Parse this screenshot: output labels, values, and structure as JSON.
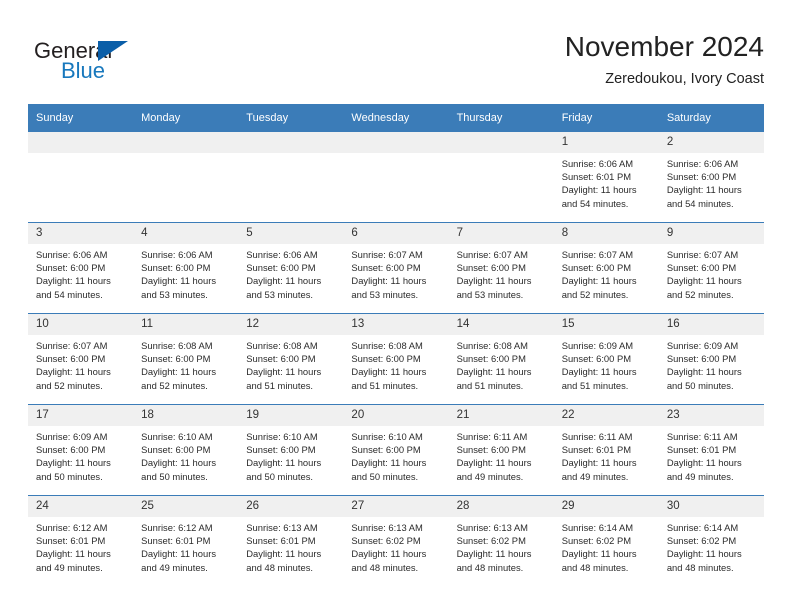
{
  "brand": {
    "name_part1": "General",
    "name_part2": "Blue",
    "accent_color": "#0a5ea8",
    "blue_text_color": "#1878bd"
  },
  "header": {
    "title": "November 2024",
    "subtitle": "Zeredoukou, Ivory Coast"
  },
  "theme": {
    "header_row_bg": "#3b7cb8",
    "daynum_bg": "#f0f0f0",
    "text_color": "#222222"
  },
  "columns": [
    {
      "label": "Sunday"
    },
    {
      "label": "Monday"
    },
    {
      "label": "Tuesday"
    },
    {
      "label": "Wednesday"
    },
    {
      "label": "Thursday"
    },
    {
      "label": "Friday"
    },
    {
      "label": "Saturday"
    }
  ],
  "weeks": [
    {
      "days": [
        {
          "daynum": "",
          "empty": true,
          "sunrise": "",
          "sunset": "",
          "daylight_line1": "",
          "daylight_line2": ""
        },
        {
          "daynum": "",
          "empty": true,
          "sunrise": "",
          "sunset": "",
          "daylight_line1": "",
          "daylight_line2": ""
        },
        {
          "daynum": "",
          "empty": true,
          "sunrise": "",
          "sunset": "",
          "daylight_line1": "",
          "daylight_line2": ""
        },
        {
          "daynum": "",
          "empty": true,
          "sunrise": "",
          "sunset": "",
          "daylight_line1": "",
          "daylight_line2": ""
        },
        {
          "daynum": "",
          "empty": true,
          "sunrise": "",
          "sunset": "",
          "daylight_line1": "",
          "daylight_line2": ""
        },
        {
          "daynum": "1",
          "empty": false,
          "sunrise": "Sunrise: 6:06 AM",
          "sunset": "Sunset: 6:01 PM",
          "daylight_line1": "Daylight: 11 hours",
          "daylight_line2": "and 54 minutes."
        },
        {
          "daynum": "2",
          "empty": false,
          "sunrise": "Sunrise: 6:06 AM",
          "sunset": "Sunset: 6:00 PM",
          "daylight_line1": "Daylight: 11 hours",
          "daylight_line2": "and 54 minutes."
        }
      ]
    },
    {
      "days": [
        {
          "daynum": "3",
          "empty": false,
          "sunrise": "Sunrise: 6:06 AM",
          "sunset": "Sunset: 6:00 PM",
          "daylight_line1": "Daylight: 11 hours",
          "daylight_line2": "and 54 minutes."
        },
        {
          "daynum": "4",
          "empty": false,
          "sunrise": "Sunrise: 6:06 AM",
          "sunset": "Sunset: 6:00 PM",
          "daylight_line1": "Daylight: 11 hours",
          "daylight_line2": "and 53 minutes."
        },
        {
          "daynum": "5",
          "empty": false,
          "sunrise": "Sunrise: 6:06 AM",
          "sunset": "Sunset: 6:00 PM",
          "daylight_line1": "Daylight: 11 hours",
          "daylight_line2": "and 53 minutes."
        },
        {
          "daynum": "6",
          "empty": false,
          "sunrise": "Sunrise: 6:07 AM",
          "sunset": "Sunset: 6:00 PM",
          "daylight_line1": "Daylight: 11 hours",
          "daylight_line2": "and 53 minutes."
        },
        {
          "daynum": "7",
          "empty": false,
          "sunrise": "Sunrise: 6:07 AM",
          "sunset": "Sunset: 6:00 PM",
          "daylight_line1": "Daylight: 11 hours",
          "daylight_line2": "and 53 minutes."
        },
        {
          "daynum": "8",
          "empty": false,
          "sunrise": "Sunrise: 6:07 AM",
          "sunset": "Sunset: 6:00 PM",
          "daylight_line1": "Daylight: 11 hours",
          "daylight_line2": "and 52 minutes."
        },
        {
          "daynum": "9",
          "empty": false,
          "sunrise": "Sunrise: 6:07 AM",
          "sunset": "Sunset: 6:00 PM",
          "daylight_line1": "Daylight: 11 hours",
          "daylight_line2": "and 52 minutes."
        }
      ]
    },
    {
      "days": [
        {
          "daynum": "10",
          "empty": false,
          "sunrise": "Sunrise: 6:07 AM",
          "sunset": "Sunset: 6:00 PM",
          "daylight_line1": "Daylight: 11 hours",
          "daylight_line2": "and 52 minutes."
        },
        {
          "daynum": "11",
          "empty": false,
          "sunrise": "Sunrise: 6:08 AM",
          "sunset": "Sunset: 6:00 PM",
          "daylight_line1": "Daylight: 11 hours",
          "daylight_line2": "and 52 minutes."
        },
        {
          "daynum": "12",
          "empty": false,
          "sunrise": "Sunrise: 6:08 AM",
          "sunset": "Sunset: 6:00 PM",
          "daylight_line1": "Daylight: 11 hours",
          "daylight_line2": "and 51 minutes."
        },
        {
          "daynum": "13",
          "empty": false,
          "sunrise": "Sunrise: 6:08 AM",
          "sunset": "Sunset: 6:00 PM",
          "daylight_line1": "Daylight: 11 hours",
          "daylight_line2": "and 51 minutes."
        },
        {
          "daynum": "14",
          "empty": false,
          "sunrise": "Sunrise: 6:08 AM",
          "sunset": "Sunset: 6:00 PM",
          "daylight_line1": "Daylight: 11 hours",
          "daylight_line2": "and 51 minutes."
        },
        {
          "daynum": "15",
          "empty": false,
          "sunrise": "Sunrise: 6:09 AM",
          "sunset": "Sunset: 6:00 PM",
          "daylight_line1": "Daylight: 11 hours",
          "daylight_line2": "and 51 minutes."
        },
        {
          "daynum": "16",
          "empty": false,
          "sunrise": "Sunrise: 6:09 AM",
          "sunset": "Sunset: 6:00 PM",
          "daylight_line1": "Daylight: 11 hours",
          "daylight_line2": "and 50 minutes."
        }
      ]
    },
    {
      "days": [
        {
          "daynum": "17",
          "empty": false,
          "sunrise": "Sunrise: 6:09 AM",
          "sunset": "Sunset: 6:00 PM",
          "daylight_line1": "Daylight: 11 hours",
          "daylight_line2": "and 50 minutes."
        },
        {
          "daynum": "18",
          "empty": false,
          "sunrise": "Sunrise: 6:10 AM",
          "sunset": "Sunset: 6:00 PM",
          "daylight_line1": "Daylight: 11 hours",
          "daylight_line2": "and 50 minutes."
        },
        {
          "daynum": "19",
          "empty": false,
          "sunrise": "Sunrise: 6:10 AM",
          "sunset": "Sunset: 6:00 PM",
          "daylight_line1": "Daylight: 11 hours",
          "daylight_line2": "and 50 minutes."
        },
        {
          "daynum": "20",
          "empty": false,
          "sunrise": "Sunrise: 6:10 AM",
          "sunset": "Sunset: 6:00 PM",
          "daylight_line1": "Daylight: 11 hours",
          "daylight_line2": "and 50 minutes."
        },
        {
          "daynum": "21",
          "empty": false,
          "sunrise": "Sunrise: 6:11 AM",
          "sunset": "Sunset: 6:00 PM",
          "daylight_line1": "Daylight: 11 hours",
          "daylight_line2": "and 49 minutes."
        },
        {
          "daynum": "22",
          "empty": false,
          "sunrise": "Sunrise: 6:11 AM",
          "sunset": "Sunset: 6:01 PM",
          "daylight_line1": "Daylight: 11 hours",
          "daylight_line2": "and 49 minutes."
        },
        {
          "daynum": "23",
          "empty": false,
          "sunrise": "Sunrise: 6:11 AM",
          "sunset": "Sunset: 6:01 PM",
          "daylight_line1": "Daylight: 11 hours",
          "daylight_line2": "and 49 minutes."
        }
      ]
    },
    {
      "days": [
        {
          "daynum": "24",
          "empty": false,
          "sunrise": "Sunrise: 6:12 AM",
          "sunset": "Sunset: 6:01 PM",
          "daylight_line1": "Daylight: 11 hours",
          "daylight_line2": "and 49 minutes."
        },
        {
          "daynum": "25",
          "empty": false,
          "sunrise": "Sunrise: 6:12 AM",
          "sunset": "Sunset: 6:01 PM",
          "daylight_line1": "Daylight: 11 hours",
          "daylight_line2": "and 49 minutes."
        },
        {
          "daynum": "26",
          "empty": false,
          "sunrise": "Sunrise: 6:13 AM",
          "sunset": "Sunset: 6:01 PM",
          "daylight_line1": "Daylight: 11 hours",
          "daylight_line2": "and 48 minutes."
        },
        {
          "daynum": "27",
          "empty": false,
          "sunrise": "Sunrise: 6:13 AM",
          "sunset": "Sunset: 6:02 PM",
          "daylight_line1": "Daylight: 11 hours",
          "daylight_line2": "and 48 minutes."
        },
        {
          "daynum": "28",
          "empty": false,
          "sunrise": "Sunrise: 6:13 AM",
          "sunset": "Sunset: 6:02 PM",
          "daylight_line1": "Daylight: 11 hours",
          "daylight_line2": "and 48 minutes."
        },
        {
          "daynum": "29",
          "empty": false,
          "sunrise": "Sunrise: 6:14 AM",
          "sunset": "Sunset: 6:02 PM",
          "daylight_line1": "Daylight: 11 hours",
          "daylight_line2": "and 48 minutes."
        },
        {
          "daynum": "30",
          "empty": false,
          "sunrise": "Sunrise: 6:14 AM",
          "sunset": "Sunset: 6:02 PM",
          "daylight_line1": "Daylight: 11 hours",
          "daylight_line2": "and 48 minutes."
        }
      ]
    }
  ]
}
